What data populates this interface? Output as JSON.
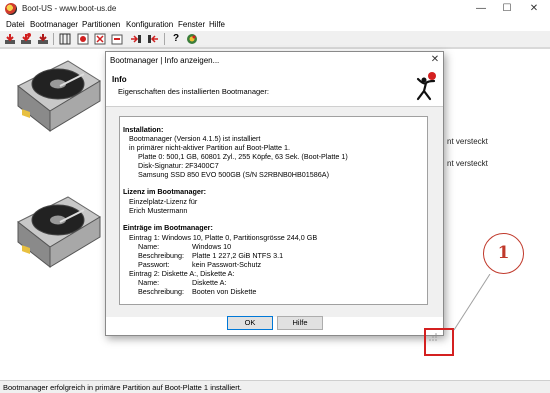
{
  "window": {
    "title": "Boot-US - www.boot-us.de",
    "minimize": "—",
    "maximize": "☐",
    "close": "✕"
  },
  "menu": {
    "items": [
      "Datei",
      "Bootmanager",
      "Partitionen",
      "Konfiguration",
      "Fenster",
      "Hilfe"
    ]
  },
  "toolbar": {
    "icons": [
      "install-icon",
      "uninstall-icon",
      "bootmanager-icon",
      "sector-icon",
      "config-icon",
      "delete-icon",
      "backup-icon",
      "restore-icon",
      "move-icon",
      "help-icon",
      "info-icon"
    ],
    "help_glyph": "?"
  },
  "background": {
    "text_1": "nt versteckt",
    "text_2": "nt versteckt"
  },
  "status": {
    "text": "Bootmanager erfolgreich in primäre Partition auf Boot-Platte 1 installiert."
  },
  "dialog": {
    "title": "Bootmanager | Info anzeigen...",
    "close": "✕",
    "header_title": "Info",
    "header_subtitle": "Eigenschaften des installierten Bootmanager:",
    "lines": {
      "l1": "Installation:",
      "l2": "Bootmanager (Version 4.1.5) ist installiert",
      "l3": "in primärer nicht-aktiver Partition auf Boot-Platte 1.",
      "l4": "Platte 0:  500,1 GB,  60801 Zyl., 255 Köpfe, 63 Sek. (Boot-Platte 1)",
      "l5": "Disk-Signatur: 2F3400C7",
      "l6": "Samsung SSD 850 EVO 500GB  (S/N S2RBNB0HB01586A)",
      "l7": "Lizenz im Bootmanager:",
      "l8": "Einzelplatz-Lizenz für",
      "l9": "Erich Mustermann",
      "l10": "Einträge im Bootmanager:",
      "l11": "Eintrag 1:  Windows 10,  Platte 0,  Partitionsgrösse 244,0 GB",
      "l12_label": "Name:",
      "l12_value": "Windows 10",
      "l13_label": "Beschreibung:",
      "l13_value": "Platte 1   227,2 GiB    NTFS 3.1",
      "l14_label": "Passwort:",
      "l14_value": "kein Passwort-Schutz",
      "l15": "Eintrag 2:  Diskette A:,  Diskette A:",
      "l16_label": "Name:",
      "l16_value": "Diskette A:",
      "l17_label": "Beschreibung:",
      "l17_value": "Booten von Diskette"
    },
    "ok_label": "OK",
    "help_label": "Hilfe"
  },
  "annotation": {
    "number": "1"
  }
}
